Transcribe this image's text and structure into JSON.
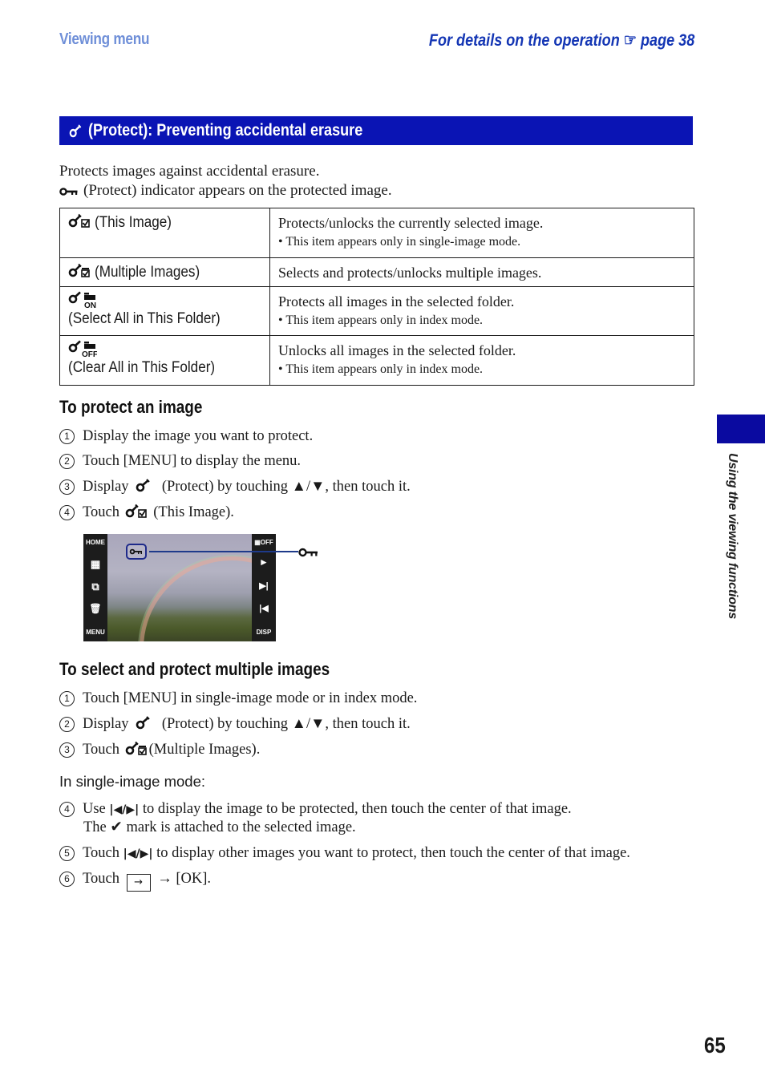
{
  "header": {
    "section": "Viewing menu",
    "reference_prefix": "For details on the operation",
    "reference_icon": "pointing-hand-icon",
    "reference_page": "page 38"
  },
  "banner": {
    "icon": "key-icon",
    "title": "(Protect): Preventing accidental erasure"
  },
  "intro": {
    "line1": "Protects images against accidental erasure.",
    "line2_icon": "protect-indicator-icon",
    "line2": "(Protect) indicator appears on the protected image."
  },
  "options_table": [
    {
      "icon": "protect-this-image-icon",
      "label": "(This Image)",
      "description": "Protects/unlocks the currently selected image.",
      "note": "• This item appears only in single-image mode."
    },
    {
      "icon": "protect-multiple-images-icon",
      "label": "(Multiple Images)",
      "description": "Selects and protects/unlocks multiple images.",
      "note": ""
    },
    {
      "icon": "protect-select-all-icon",
      "label": "(Select All in This Folder)",
      "description": "Protects all images in the selected folder.",
      "note": "• This item appears only in index mode."
    },
    {
      "icon": "protect-clear-all-icon",
      "label": "(Clear All in This Folder)",
      "description": "Unlocks all images in the selected folder.",
      "note": "• This item appears only in index mode."
    }
  ],
  "section_protect": {
    "heading": "To protect an image",
    "steps": [
      {
        "num": "1",
        "text": "Display the image you want to protect."
      },
      {
        "num": "2",
        "text": "Touch [MENU] to display the menu."
      },
      {
        "num": "3",
        "pre": "Display",
        "post": "(Protect) by touching ▲/▼, then touch it."
      },
      {
        "num": "4",
        "pre": "Touch",
        "post": "(This Image)."
      }
    ]
  },
  "camera_screen": {
    "left_buttons": [
      "HOME",
      "MENU"
    ],
    "right_buttons": [
      "OFF",
      "DISP"
    ],
    "callout_icon": "protect-indicator-icon"
  },
  "section_multiple": {
    "heading": "To select and protect multiple images",
    "steps": [
      {
        "num": "1",
        "text": "Touch [MENU] in single-image mode or in index mode."
      },
      {
        "num": "2",
        "pre": "Display",
        "post": "(Protect) by touching ▲/▼, then touch it."
      },
      {
        "num": "3",
        "pre": "Touch",
        "post": "(Multiple Images)."
      }
    ],
    "subheading": "In single-image mode:",
    "steps_single": [
      {
        "num": "4",
        "pre": "Use",
        "post": "to display the image to be protected, then touch the center of that image.",
        "line2_pre": "The",
        "line2_post": "mark is attached to the selected image."
      },
      {
        "num": "5",
        "pre": "Touch",
        "post": "to display other images you want to protect, then touch the center of that image."
      },
      {
        "num": "6",
        "pre": "Touch",
        "post": "→ [OK]."
      }
    ]
  },
  "side_tab": {
    "label": "Using the viewing functions",
    "color": "#0a0aa0"
  },
  "page_number": "65",
  "colors": {
    "banner": "#0a14b4",
    "header_left": "#6f8fd8",
    "header_right": "#1436b4"
  }
}
